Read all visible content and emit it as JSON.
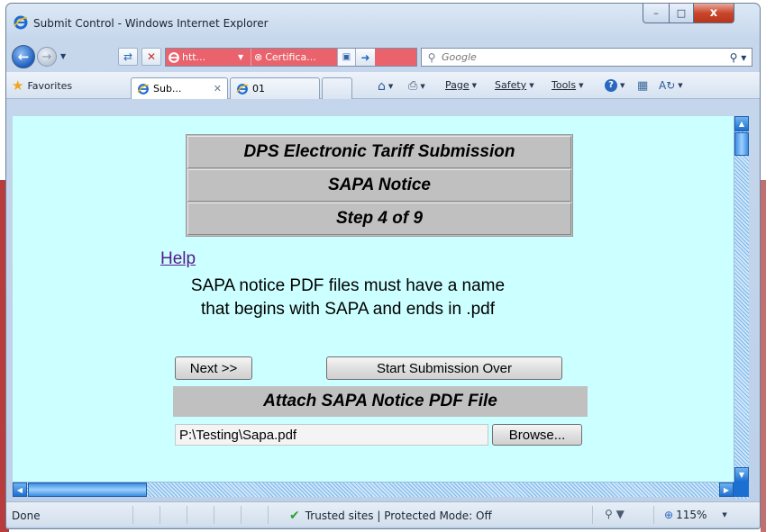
{
  "window": {
    "title": "Submit Control - Windows Internet Explorer",
    "caption_buttons": {
      "minimize": "–",
      "maximize": "□",
      "close": "x"
    }
  },
  "nav": {
    "address_text": "htt...",
    "certificate_text": "Certifica...",
    "search_placeholder": "Google"
  },
  "command_bar": {
    "favorites_label": "Favorites",
    "tabs": [
      {
        "label": "Sub...",
        "active": true
      },
      {
        "label": "01",
        "active": false
      }
    ],
    "menus": [
      "Page",
      "Safety",
      "Tools"
    ]
  },
  "page": {
    "header_rows": [
      "DPS Electronic Tariff Submission",
      "SAPA Notice",
      "Step 4 of 9"
    ],
    "help_link": "Help",
    "instruction_line1": "SAPA notice PDF files must have a name",
    "instruction_line2": "that begins with SAPA and ends in .pdf",
    "next_button": "Next >>",
    "restart_button": "Start Submission Over",
    "attach_header": "Attach SAPA Notice PDF File",
    "file_value": "P:\\Testing\\Sapa.pdf",
    "browse_button": "Browse..."
  },
  "status": {
    "left_text": "Done",
    "zone_text": "Trusted sites | Protected Mode: Off",
    "zoom_text": "115%"
  },
  "colors": {
    "content_background": "#ccffff",
    "header_background": "#c0c0c0",
    "link_color": "#551a8b"
  }
}
